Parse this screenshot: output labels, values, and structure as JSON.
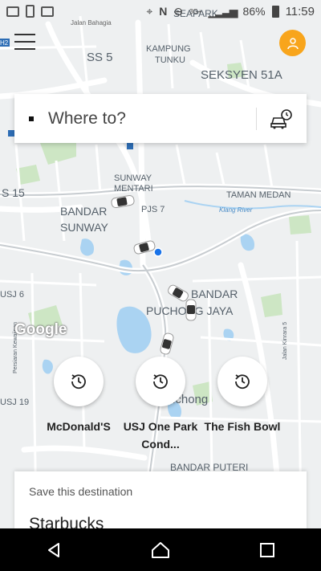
{
  "status_bar": {
    "network_label": "3G+",
    "battery": "86%",
    "time": "11:59"
  },
  "map": {
    "labels": [
      "Jalan Bahagia",
      "SEAPARK",
      "SS 5",
      "KAMPUNG",
      "TUNKU",
      "SEKSYEN 51A",
      "SUNWAY",
      "MENTARI",
      "TAMAN MEDAN",
      "S 15",
      "BANDAR",
      "SUNWAY",
      "PJS 7",
      "Klang River",
      "USJ 6",
      "BANDAR",
      "PUCHONG JAYA",
      "Persiaran Kewajipan",
      "Jalan Kinrara 5",
      "USJ 19",
      "Puchong",
      "BANDAR PUTERI",
      "H2"
    ],
    "attribution": "Google"
  },
  "search": {
    "placeholder": "Where to?"
  },
  "shortcuts": [
    {
      "label": "McDonald'S"
    },
    {
      "label": "USJ One Park Cond..."
    },
    {
      "label": "The Fish Bowl"
    }
  ],
  "save_card": {
    "title": "Save this destination",
    "place": "Starbucks"
  },
  "colors": {
    "accent": "#f8a51c",
    "user_location": "#1a73e8",
    "map_bg": "#eef0f1",
    "road": "#ffffff",
    "water": "#aad3f2",
    "park": "#cde6c4"
  },
  "icons": {
    "menu": "menu-icon",
    "profile": "profile-icon",
    "history": "history-icon",
    "schedule": "schedule-ride-icon",
    "back": "back-icon",
    "home": "home-icon",
    "recents": "recents-icon"
  }
}
